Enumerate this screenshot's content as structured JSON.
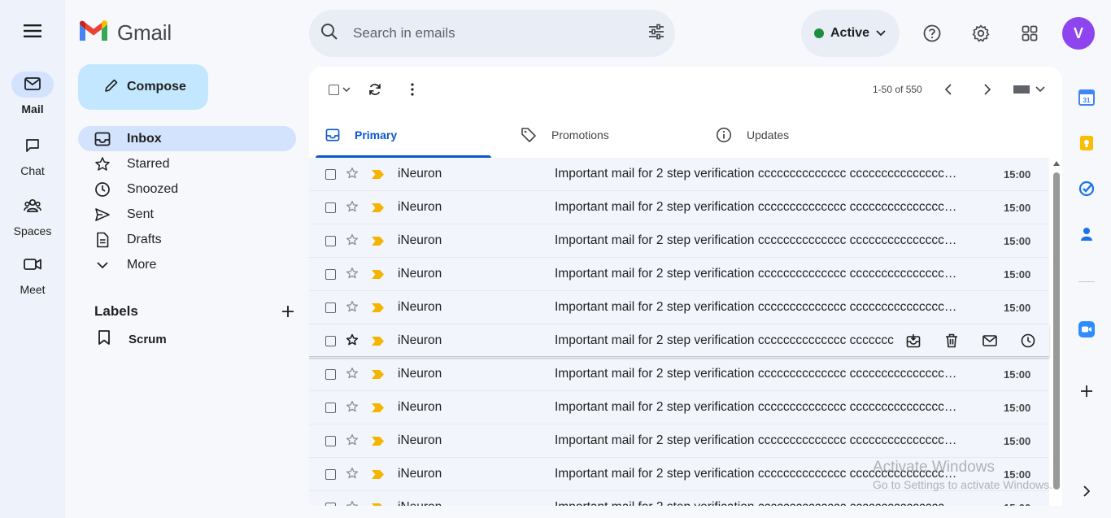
{
  "rail": {
    "items": [
      {
        "label": "Mail",
        "icon": "mail-icon"
      },
      {
        "label": "Chat",
        "icon": "chat-icon"
      },
      {
        "label": "Spaces",
        "icon": "spaces-icon"
      },
      {
        "label": "Meet",
        "icon": "meet-icon"
      }
    ]
  },
  "app": {
    "name": "Gmail"
  },
  "compose": {
    "label": "Compose"
  },
  "nav": {
    "items": [
      {
        "label": "Inbox",
        "icon": "inbox-icon"
      },
      {
        "label": "Starred",
        "icon": "star-icon"
      },
      {
        "label": "Snoozed",
        "icon": "clock-icon"
      },
      {
        "label": "Sent",
        "icon": "send-icon"
      },
      {
        "label": "Drafts",
        "icon": "draft-icon"
      },
      {
        "label": "More",
        "icon": "chevron-down-icon"
      }
    ]
  },
  "labels": {
    "heading": "Labels",
    "items": [
      {
        "label": "Scrum"
      }
    ]
  },
  "search": {
    "placeholder": "Search in emails"
  },
  "status": {
    "label": "Active",
    "color": "#1e8e3e"
  },
  "user": {
    "initial": "V",
    "color": "#8e44ef"
  },
  "toolbar": {
    "pager": "1-50 of 550"
  },
  "tabs": [
    {
      "label": "Primary",
      "icon": "inbox-icon"
    },
    {
      "label": "Promotions",
      "icon": "tag-icon"
    },
    {
      "label": "Updates",
      "icon": "info-icon"
    }
  ],
  "emails": {
    "sender": "iNeuron",
    "subject": "Important mail for 2 step verification cccccccccccccc cccccccccccccccc...",
    "subject_hover": "Important mail for 2 step verification cccccccccccccc ccccccc",
    "time": "15:00",
    "count": 11,
    "hover_index": 5
  },
  "watermark": {
    "line1": "Activate Windows",
    "line2": "Go to Settings to activate Windows."
  },
  "colors": {
    "accent": "#0b57d0",
    "compose_bg": "#c2e7ff",
    "active_nav": "#d3e3fd",
    "important": "#f4b400"
  }
}
